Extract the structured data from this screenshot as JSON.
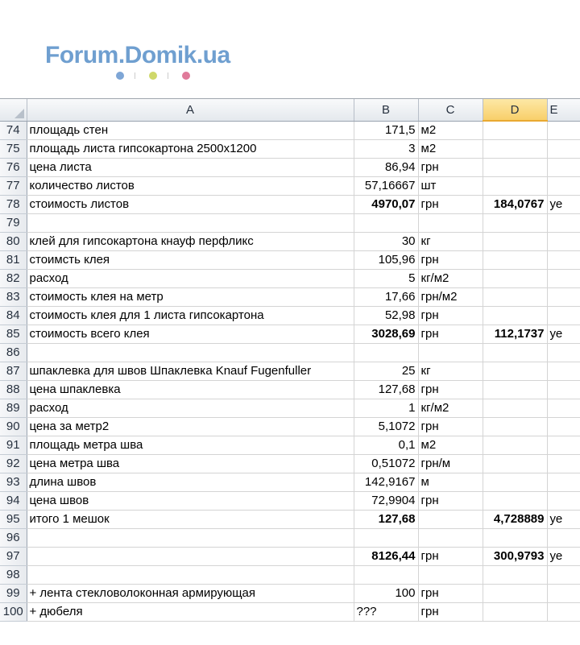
{
  "logo": {
    "text": "Forum.Domik.ua",
    "dot_colors": [
      "#7ea6d6",
      "#cfd86a",
      "#e07a9a"
    ],
    "text_color": "#6f9fd0"
  },
  "sheet": {
    "selected_column": "D",
    "columns": [
      "A",
      "B",
      "C",
      "D",
      "E"
    ],
    "rows": [
      {
        "num": "74",
        "a": "площадь стен",
        "b": "171,5",
        "c": "м2",
        "d": "",
        "e": "",
        "bold_b": false,
        "bold_d": false
      },
      {
        "num": "75",
        "a": "площадь листа гипсокартона 2500х1200",
        "b": "3",
        "c": "м2",
        "d": "",
        "e": "",
        "bold_b": false,
        "bold_d": false
      },
      {
        "num": "76",
        "a": "цена листа",
        "b": "86,94",
        "c": "грн",
        "d": "",
        "e": "",
        "bold_b": false,
        "bold_d": false
      },
      {
        "num": "77",
        "a": "количество листов",
        "b": "57,16667",
        "c": "шт",
        "d": "",
        "e": "",
        "bold_b": false,
        "bold_d": false
      },
      {
        "num": "78",
        "a": "стоимость листов",
        "b": "4970,07",
        "c": "грн",
        "d": "184,0767",
        "e": "уе",
        "bold_b": true,
        "bold_d": true
      },
      {
        "num": "79",
        "a": "",
        "b": "",
        "c": "",
        "d": "",
        "e": "",
        "bold_b": false,
        "bold_d": false
      },
      {
        "num": "80",
        "a": "клей для гипсокартона кнауф перфликс",
        "b": "30",
        "c": "кг",
        "d": "",
        "e": "",
        "bold_b": false,
        "bold_d": false
      },
      {
        "num": "81",
        "a": "стоимсть клея",
        "b": "105,96",
        "c": "грн",
        "d": "",
        "e": "",
        "bold_b": false,
        "bold_d": false
      },
      {
        "num": "82",
        "a": "расход",
        "b": "5",
        "c": "кг/м2",
        "d": "",
        "e": "",
        "bold_b": false,
        "bold_d": false
      },
      {
        "num": "83",
        "a": "стоимость клея на метр",
        "b": "17,66",
        "c": "грн/м2",
        "d": "",
        "e": "",
        "bold_b": false,
        "bold_d": false
      },
      {
        "num": "84",
        "a": "стоимость клея для 1 листа гипсокартона",
        "b": "52,98",
        "c": "грн",
        "d": "",
        "e": "",
        "bold_b": false,
        "bold_d": false
      },
      {
        "num": "85",
        "a": "стоимость всего клея",
        "b": "3028,69",
        "c": "грн",
        "d": "112,1737",
        "e": "уе",
        "bold_b": true,
        "bold_d": true
      },
      {
        "num": "86",
        "a": "",
        "b": "",
        "c": "",
        "d": "",
        "e": "",
        "bold_b": false,
        "bold_d": false
      },
      {
        "num": "87",
        "a": "шпаклевка для швов Шпаклевка Knauf Fugenfuller",
        "b": "25",
        "c": "кг",
        "d": "",
        "e": "",
        "bold_b": false,
        "bold_d": false
      },
      {
        "num": "88",
        "a": "цена шпаклевка",
        "b": "127,68",
        "c": "грн",
        "d": "",
        "e": "",
        "bold_b": false,
        "bold_d": false
      },
      {
        "num": "89",
        "a": "расход",
        "b": "1",
        "c": "кг/м2",
        "d": "",
        "e": "",
        "bold_b": false,
        "bold_d": false
      },
      {
        "num": "90",
        "a": "цена за метр2",
        "b": "5,1072",
        "c": "грн",
        "d": "",
        "e": "",
        "bold_b": false,
        "bold_d": false
      },
      {
        "num": "91",
        "a": "площадь метра шва",
        "b": "0,1",
        "c": "м2",
        "d": "",
        "e": "",
        "bold_b": false,
        "bold_d": false
      },
      {
        "num": "92",
        "a": "цена метра  шва",
        "b": "0,51072",
        "c": "грн/м",
        "d": "",
        "e": "",
        "bold_b": false,
        "bold_d": false
      },
      {
        "num": "93",
        "a": "длина швов",
        "b": "142,9167",
        "c": "м",
        "d": "",
        "e": "",
        "bold_b": false,
        "bold_d": false
      },
      {
        "num": "94",
        "a": "цена швов",
        "b": "72,9904",
        "c": "грн",
        "d": "",
        "e": "",
        "bold_b": false,
        "bold_d": false
      },
      {
        "num": "95",
        "a": "итого 1 мешок",
        "b": "127,68",
        "c": "",
        "d": "4,728889",
        "e": "уе",
        "bold_b": true,
        "bold_d": true
      },
      {
        "num": "96",
        "a": "",
        "b": "",
        "c": "",
        "d": "",
        "e": "",
        "bold_b": false,
        "bold_d": false
      },
      {
        "num": "97",
        "a": "",
        "b": "8126,44",
        "c": "грн",
        "d": "300,9793",
        "e": "уе",
        "bold_b": true,
        "bold_d": true
      },
      {
        "num": "98",
        "a": "",
        "b": "",
        "c": "",
        "d": "",
        "e": "",
        "bold_b": false,
        "bold_d": false
      },
      {
        "num": "99",
        "a": "+ лента стекловолоконная армирующая",
        "b": "100",
        "c": "грн",
        "d": "",
        "e": "",
        "bold_b": false,
        "bold_d": false
      },
      {
        "num": "100",
        "a": "+ дюбеля",
        "b": "???",
        "c": "грн",
        "d": "",
        "e": "",
        "bold_b": false,
        "bold_d": false,
        "b_align": "left"
      }
    ]
  }
}
